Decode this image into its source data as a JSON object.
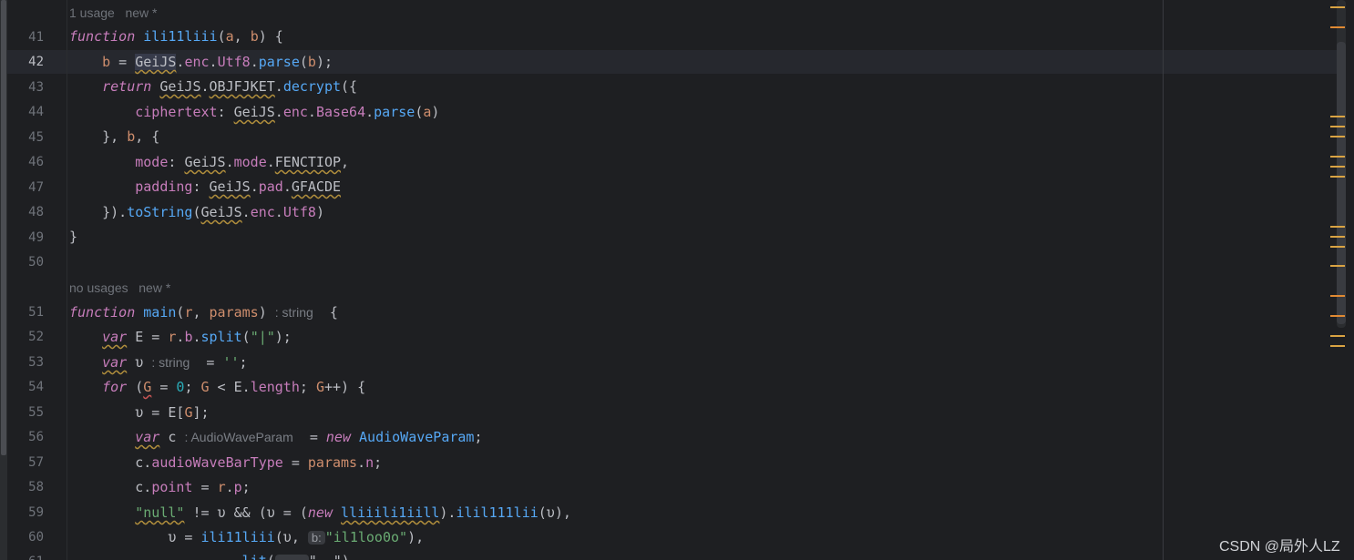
{
  "editor": {
    "hints": {
      "h1": "1 usage   new *",
      "h2": "no usages   new *"
    },
    "line_numbers": [
      "41",
      "42",
      "43",
      "44",
      "45",
      "46",
      "47",
      "48",
      "49",
      "50",
      "51",
      "52",
      "53",
      "54",
      "55",
      "56",
      "57",
      "58",
      "59",
      "60",
      "61"
    ],
    "tokens": {
      "function": "function",
      "return": "return",
      "var": "var",
      "for": "for",
      "new": "new",
      "fn_ili": "ili11liii",
      "fn_main": "main",
      "GeiJS": "GeiJS",
      "enc": "enc",
      "Utf8": "Utf8",
      "parse": "parse",
      "OBJFJKET": "OBJFJKET",
      "decrypt": "decrypt",
      "ciphertext": "ciphertext",
      "Base64": "Base64",
      "mode": "mode",
      "FENCTIOP": "FENCTIOP",
      "padding": "padding",
      "pad": "pad",
      "GFACDE": "GFACDE",
      "toString": "toString",
      "split": "split",
      "length": "length",
      "AudioWaveParam": "AudioWaveParam",
      "audioWaveBarType": "audioWaveBarType",
      "point": "point",
      "lliiilillill": "lliiili1iill",
      "ilil111lii": "ilil111lii",
      "str_pipe": "\"|\"",
      "str_empty": "''",
      "str_null": "\"null\"",
      "str_il1": "\"il1loo0o\"",
      "num_zero": "0",
      "inlay_string": ": string",
      "inlay_awp": ": AudioWaveParam",
      "inlay_b": "b:"
    }
  },
  "watermark": "CSDN @局外人LZ",
  "colors": {
    "background": "#1e1f22",
    "keyword": "#cf8e6d",
    "function": "#56a8f5",
    "member": "#c77dbb",
    "string": "#6aab73",
    "number": "#2aacb8",
    "marker": "#d9a343"
  }
}
